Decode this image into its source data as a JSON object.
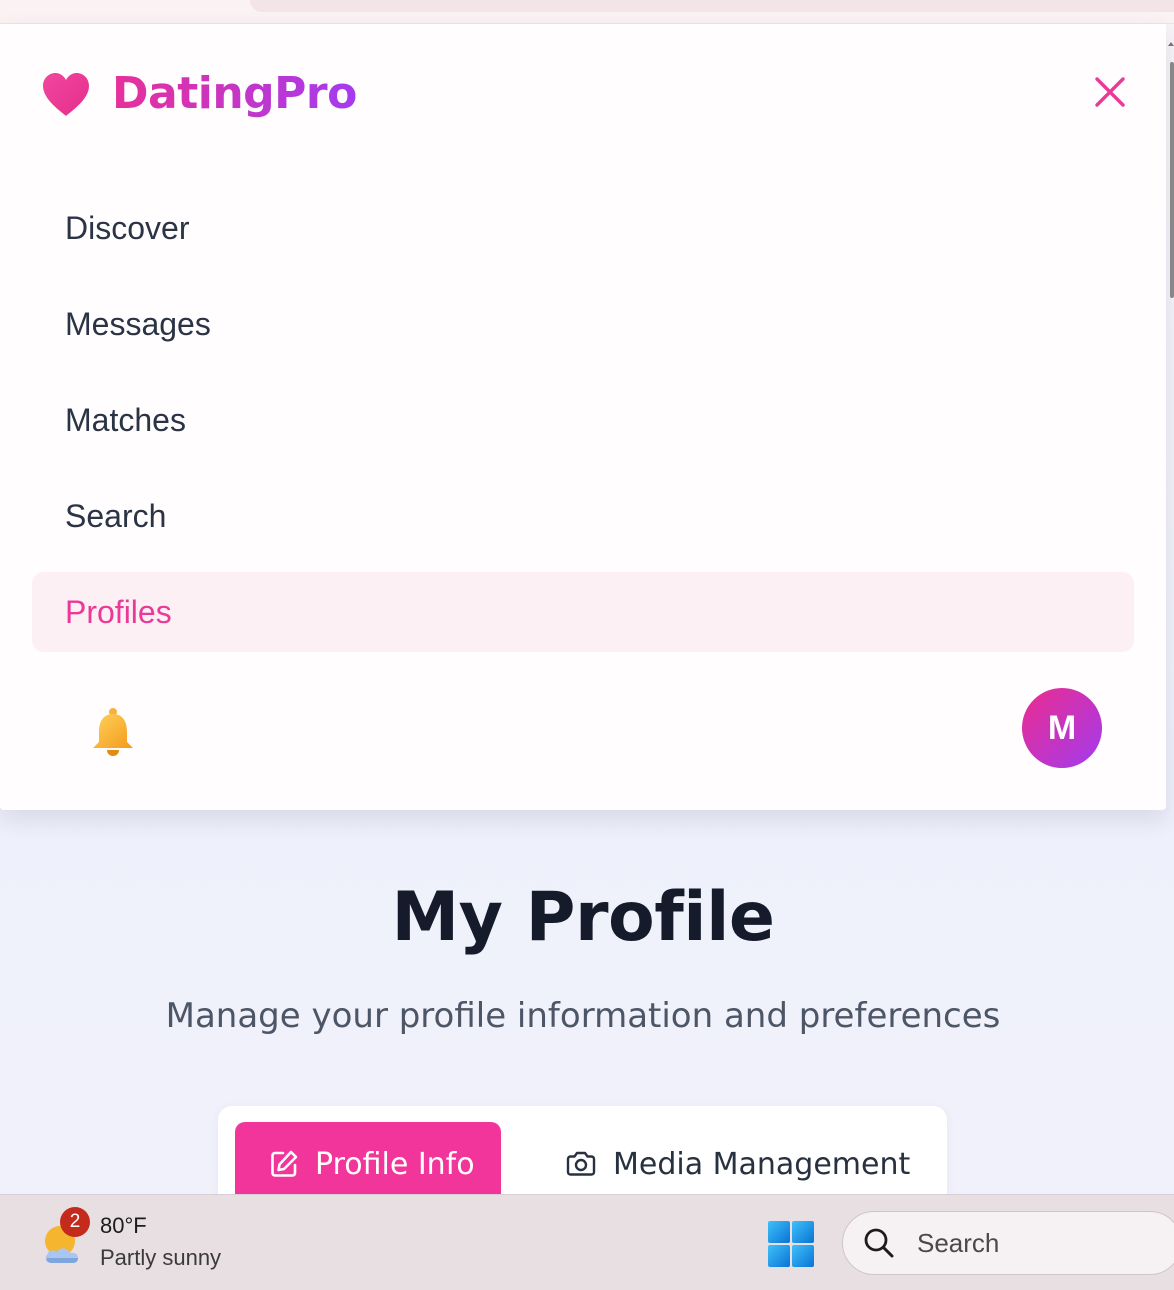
{
  "brand": {
    "name": "DatingPro"
  },
  "nav": {
    "items": [
      {
        "label": "Discover"
      },
      {
        "label": "Messages"
      },
      {
        "label": "Matches"
      },
      {
        "label": "Search"
      },
      {
        "label": "Profiles",
        "active": true
      }
    ]
  },
  "user": {
    "avatar_initial": "M"
  },
  "main": {
    "title": "My Profile",
    "subtitle": "Manage your profile information and preferences",
    "tabs": [
      {
        "label": "Profile Info",
        "icon": "edit-icon",
        "active": true
      },
      {
        "label": "Media Management",
        "icon": "camera-icon",
        "active": false
      }
    ]
  },
  "taskbar": {
    "weather": {
      "badge": "2",
      "temp": "80°F",
      "desc": "Partly sunny"
    },
    "search_label": "Search"
  },
  "colors": {
    "accent": "#f2359a",
    "brand_gradient_start": "#e8309a",
    "brand_gradient_end": "#a43bf0",
    "active_nav_bg": "#fcf0f5",
    "text_dark": "#151b2b"
  }
}
